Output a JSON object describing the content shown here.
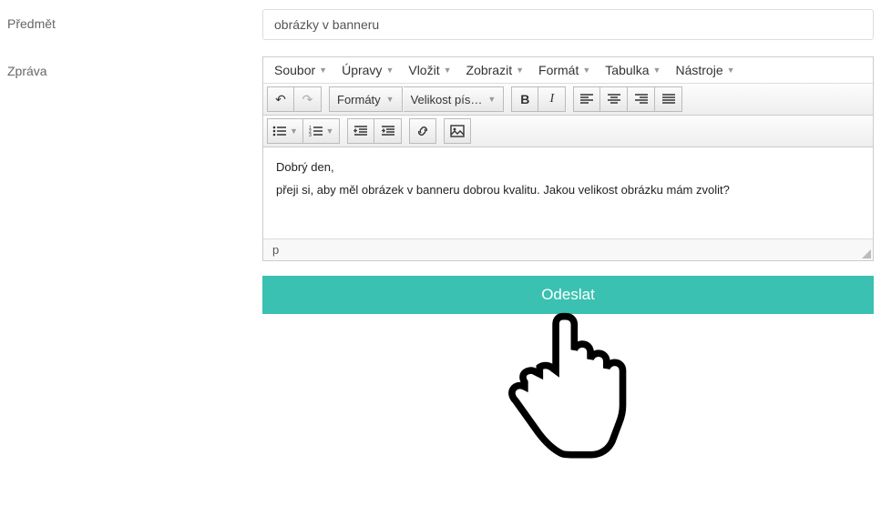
{
  "subject": {
    "label": "Předmět",
    "value": "obrázky v banneru"
  },
  "message": {
    "label": "Zpráva",
    "menubar": [
      "Soubor",
      "Úpravy",
      "Vložit",
      "Zobrazit",
      "Formát",
      "Tabulka",
      "Nástroje"
    ],
    "toolbar": {
      "formats_label": "Formáty",
      "fontsize_label": "Velikost pís…"
    },
    "body_lines": [
      "Dobrý den,",
      "přeji si, aby měl obrázek v banneru dobrou kvalitu. Jakou velikost obrázku mám zvolit?"
    ],
    "status_path": "p"
  },
  "submit_label": "Odeslat"
}
